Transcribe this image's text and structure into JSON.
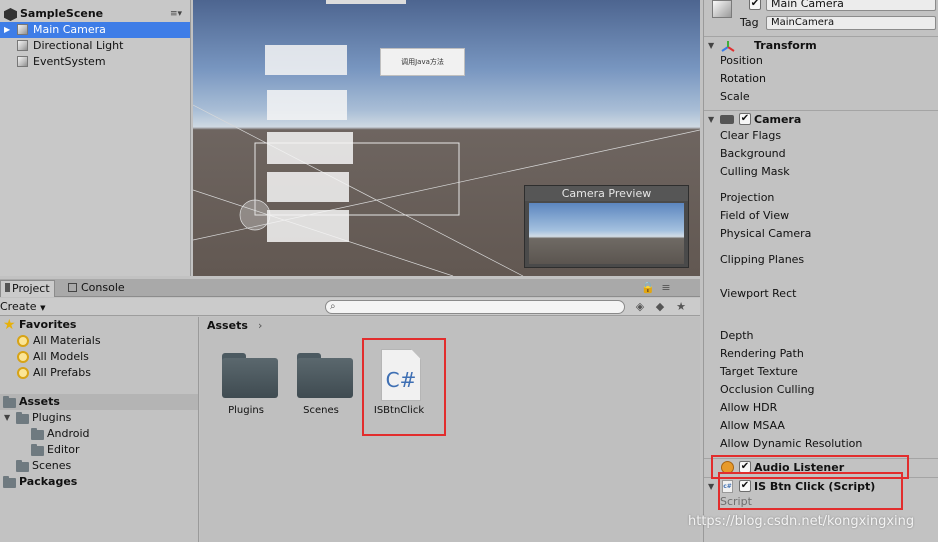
{
  "hierarchy": {
    "scene_name": "SampleScene",
    "menu_icon": "≡▾",
    "items": [
      {
        "label": "Main Camera"
      },
      {
        "label": "Directional Light"
      },
      {
        "label": "EventSystem"
      }
    ]
  },
  "scene": {
    "button_text": "调用Java方法",
    "camera_preview_title": "Camera Preview"
  },
  "project": {
    "tabs": [
      {
        "label": "Project"
      },
      {
        "label": "Console"
      }
    ],
    "create_label": "Create",
    "favorites": {
      "label": "Favorites",
      "items": [
        {
          "label": "All Materials"
        },
        {
          "label": "All Models"
        },
        {
          "label": "All Prefabs"
        }
      ]
    },
    "assets_label": "Assets",
    "tree": [
      {
        "label": "Plugins"
      },
      {
        "label": "Android"
      },
      {
        "label": "Editor"
      },
      {
        "label": "Scenes"
      }
    ],
    "packages_label": "Packages",
    "breadcrumb": "Assets",
    "breadcrumb_sep": "›",
    "files": [
      {
        "label": "Plugins"
      },
      {
        "label": "Scenes"
      },
      {
        "label": "ISBtnClick",
        "icon_text": "C#"
      }
    ]
  },
  "inspector": {
    "object_name": "Main Camera",
    "tag_label": "Tag",
    "tag_value": "MainCamera",
    "transform": {
      "title": "Transform",
      "props": [
        {
          "label": "Position"
        },
        {
          "label": "Rotation"
        },
        {
          "label": "Scale"
        }
      ]
    },
    "camera": {
      "title": "Camera",
      "props": [
        {
          "label": "Clear Flags"
        },
        {
          "label": "Background"
        },
        {
          "label": "Culling Mask"
        },
        {
          "label": "Projection"
        },
        {
          "label": "Field of View"
        },
        {
          "label": "Physical Camera"
        },
        {
          "label": "Clipping Planes"
        },
        {
          "label": "Viewport Rect"
        },
        {
          "label": "Depth"
        },
        {
          "label": "Rendering Path"
        },
        {
          "label": "Target Texture"
        },
        {
          "label": "Occlusion Culling"
        },
        {
          "label": "Allow HDR"
        },
        {
          "label": "Allow MSAA"
        },
        {
          "label": "Allow Dynamic Resolution"
        }
      ]
    },
    "audio_listener": {
      "title": "Audio Listener"
    },
    "script_component": {
      "title": "IS Btn Click (Script)",
      "script_label": "Script"
    }
  },
  "watermark": "https://blog.csdn.net/kongxingxing",
  "colors": {
    "selection": "#3e7de7",
    "highlight_box": "#e22d2d"
  }
}
